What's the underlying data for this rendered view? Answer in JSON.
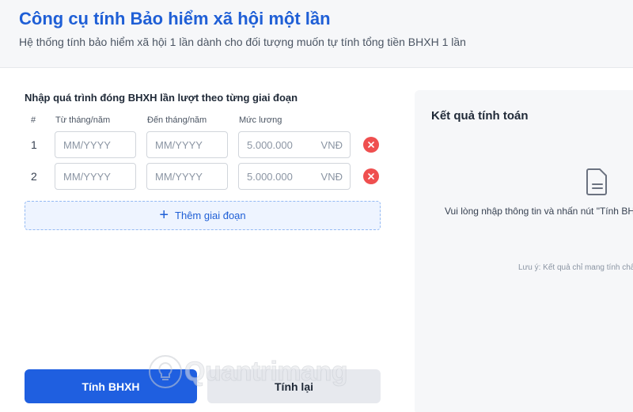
{
  "header": {
    "title": "Công cụ tính Bảo hiểm xã hội một lần",
    "subtitle": "Hệ thống tính bảo hiểm xã hội 1 lần dành cho đối tượng muốn tự tính tổng tiền BHXH 1 lần"
  },
  "form": {
    "section_label": "Nhập quá trình đóng BHXH lần lượt theo từng giai đoạn",
    "columns": {
      "num": "#",
      "from": "Từ tháng/năm",
      "to": "Đến tháng/năm",
      "salary": "Mức lương"
    },
    "rows": [
      {
        "num": "1",
        "from_placeholder": "MM/YYYY",
        "to_placeholder": "MM/YYYY",
        "salary_placeholder": "5.000.000",
        "unit": "VNĐ"
      },
      {
        "num": "2",
        "from_placeholder": "MM/YYYY",
        "to_placeholder": "MM/YYYY",
        "salary_placeholder": "5.000.000",
        "unit": "VNĐ"
      }
    ],
    "add_label": "Thêm giai đoạn"
  },
  "actions": {
    "calculate_label": "Tính BHXH",
    "reset_label": "Tính lại"
  },
  "result": {
    "title": "Kết quả tính toán",
    "hint": "Vui lòng nhập thông tin và nhấn nút \"Tính BHXH\"",
    "note": "Lưu ý: Kết quả chỉ mang tính chất tham khảo"
  },
  "watermark": {
    "text": "Quantrimang"
  },
  "icons": {
    "remove": "close-icon",
    "add": "plus-icon",
    "result_placeholder": "document-icon",
    "watermark_logo": "lightbulb-icon"
  },
  "colors": {
    "primary": "#1f5fe0",
    "title": "#1f5fd6",
    "danger": "#ef4f4f",
    "panel_bg": "#f6f7f9"
  }
}
